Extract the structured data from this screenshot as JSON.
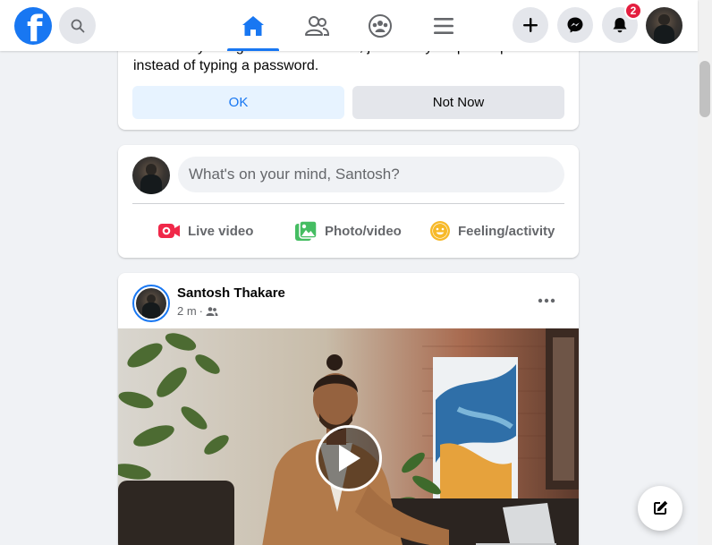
{
  "colors": {
    "brand": "#1877f2",
    "background": "#f0f2f5",
    "badge": "#e41e3f",
    "live_video": "#f02849",
    "photo_video": "#45bd62",
    "feeling": "#f7b928"
  },
  "header": {
    "logo_text": "f",
    "search_icon": "search-icon",
    "nav_tabs": [
      {
        "icon": "home-icon",
        "active": true
      },
      {
        "icon": "friends-icon",
        "active": false
      },
      {
        "icon": "groups-icon",
        "active": false
      },
      {
        "icon": "menu-icon",
        "active": false
      }
    ],
    "notification_count": "2"
  },
  "login_prompt": {
    "message": "Next time you log in on this browser, just click your profile picture instead of typing a password.",
    "ok_label": "OK",
    "not_now_label": "Not Now"
  },
  "composer": {
    "placeholder": "What's on your mind, Santosh?",
    "actions": [
      {
        "label": "Live video",
        "icon": "live-video-icon"
      },
      {
        "label": "Photo/video",
        "icon": "photo-video-icon"
      },
      {
        "label": "Feeling/activity",
        "icon": "feeling-icon"
      }
    ]
  },
  "post": {
    "author": "Santosh Thakare",
    "time": "2 m",
    "separator": "·",
    "audience_icon": "friends-audience-icon",
    "media_type": "video"
  }
}
